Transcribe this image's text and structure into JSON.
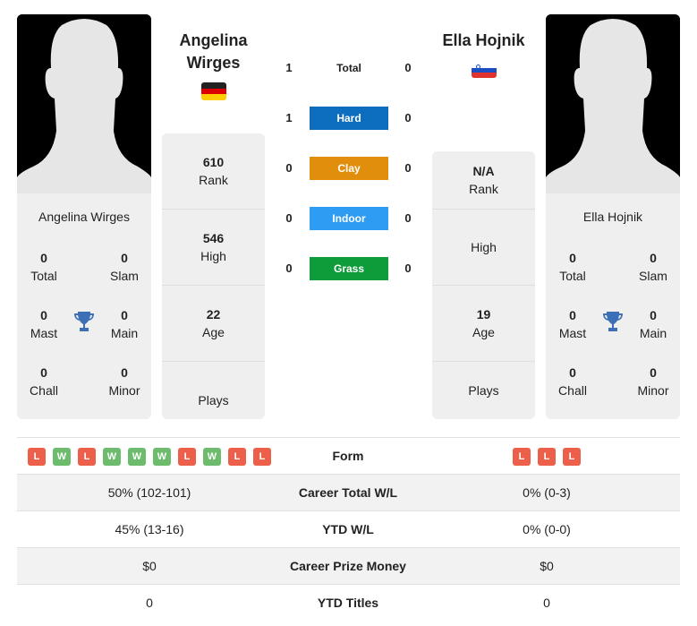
{
  "colors": {
    "hard": "#0d6ebf",
    "clay": "#e08e0b",
    "indoor": "#2f9cf3",
    "grass": "#0e9b3a",
    "loss": "#ec5f4a",
    "win": "#6dbb6d",
    "trophy": "#3d6fb6"
  },
  "player1": {
    "name": "Angelina Wirges",
    "name_line1": "Angelina",
    "name_line2": "Wirges",
    "flag": "germany-flag",
    "card_name": "Angelina Wirges",
    "titles": {
      "total": {
        "value": "0",
        "label": "Total"
      },
      "slam": {
        "value": "0",
        "label": "Slam"
      },
      "mast": {
        "value": "0",
        "label": "Mast"
      },
      "main": {
        "value": "0",
        "label": "Main"
      },
      "chall": {
        "value": "0",
        "label": "Chall"
      },
      "minor": {
        "value": "0",
        "label": "Minor"
      }
    },
    "rank": {
      "value": "610",
      "label": "Rank"
    },
    "high": {
      "value": "546",
      "label": "High"
    },
    "age": {
      "value": "22",
      "label": "Age"
    },
    "plays": {
      "value": "",
      "label": "Plays"
    }
  },
  "player2": {
    "name": "Ella Hojnik",
    "flag": "slovenia-flag",
    "card_name": "Ella Hojnik",
    "titles": {
      "total": {
        "value": "0",
        "label": "Total"
      },
      "slam": {
        "value": "0",
        "label": "Slam"
      },
      "mast": {
        "value": "0",
        "label": "Mast"
      },
      "main": {
        "value": "0",
        "label": "Main"
      },
      "chall": {
        "value": "0",
        "label": "Chall"
      },
      "minor": {
        "value": "0",
        "label": "Minor"
      }
    },
    "rank": {
      "value": "N/A",
      "label": "Rank"
    },
    "high": {
      "value": "",
      "label": "High"
    },
    "age": {
      "value": "19",
      "label": "Age"
    },
    "plays": {
      "value": "",
      "label": "Plays"
    }
  },
  "h2h": [
    {
      "label": "Total",
      "p1": "1",
      "p2": "0"
    },
    {
      "label": "Hard",
      "p1": "1",
      "p2": "0"
    },
    {
      "label": "Clay",
      "p1": "0",
      "p2": "0"
    },
    {
      "label": "Indoor",
      "p1": "0",
      "p2": "0"
    },
    {
      "label": "Grass",
      "p1": "0",
      "p2": "0"
    }
  ],
  "stats": {
    "form": {
      "label": "Form",
      "p1": [
        "L",
        "W",
        "L",
        "W",
        "W",
        "W",
        "L",
        "W",
        "L",
        "L"
      ],
      "p2": [
        "L",
        "L",
        "L"
      ]
    },
    "rows": [
      {
        "label": "Career Total W/L",
        "p1": "50% (102-101)",
        "p2": "0% (0-3)"
      },
      {
        "label": "YTD W/L",
        "p1": "45% (13-16)",
        "p2": "0% (0-0)"
      },
      {
        "label": "Career Prize Money",
        "p1": "$0",
        "p2": "$0"
      },
      {
        "label": "YTD Titles",
        "p1": "0",
        "p2": "0"
      }
    ]
  }
}
